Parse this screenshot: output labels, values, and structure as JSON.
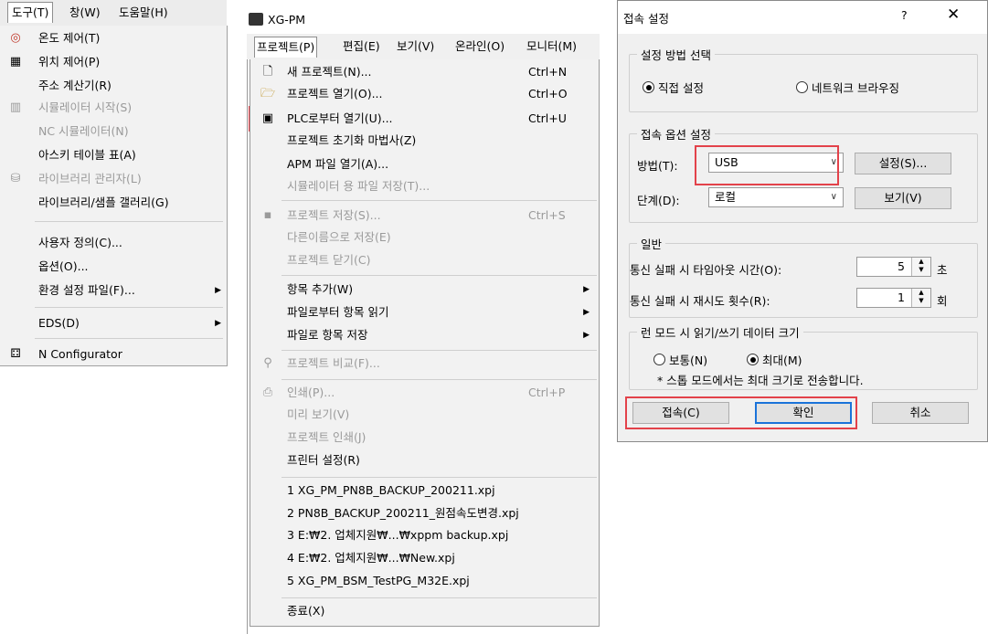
{
  "tools_panel": {
    "menubar": [
      "도구(T)",
      "창(W)",
      "도움말(H)"
    ],
    "items": [
      {
        "icon": "temperature-control-icon",
        "label": "온도 제어(T)",
        "enabled": true
      },
      {
        "icon": "position-control-icon",
        "label": "위치 제어(P)",
        "enabled": true,
        "highlighted": true
      },
      {
        "icon": "",
        "label": "주소 계산기(R)",
        "enabled": true
      },
      {
        "icon": "simulator-icon",
        "label": "시뮬레이터 시작(S)",
        "enabled": false
      },
      {
        "icon": "",
        "label": "NC 시뮬레이터(N)",
        "enabled": false
      },
      {
        "icon": "",
        "label": "아스키 테이블 표(A)",
        "enabled": true
      },
      {
        "icon": "library-icon",
        "label": "라이브러리 관리자(L)",
        "enabled": false
      },
      {
        "icon": "",
        "label": "라이브러리/샘플 갤러리(G)",
        "enabled": true
      },
      {
        "icon": "",
        "label": "사용자 정의(C)...",
        "enabled": true
      },
      {
        "icon": "",
        "label": "옵션(O)...",
        "enabled": true
      },
      {
        "icon": "",
        "label": "환경 설정 파일(F)...",
        "enabled": true,
        "submenu": true
      },
      {
        "icon": "",
        "label": "EDS(D)",
        "enabled": true,
        "submenu": true
      },
      {
        "icon": "n-configurator-icon",
        "label": "N Configurator",
        "enabled": true
      }
    ]
  },
  "project_panel": {
    "app_title": "XG-PM",
    "menubar": [
      "프로젝트(P)",
      "편집(E)",
      "보기(V)",
      "온라인(O)",
      "모니터(M)"
    ],
    "items": [
      {
        "label": "새 프로젝트(N)...",
        "shortcut": "Ctrl+N",
        "enabled": true
      },
      {
        "label": "프로젝트 열기(O)...",
        "shortcut": "Ctrl+O",
        "enabled": true
      },
      {
        "label": "PLC로부터 열기(U)...",
        "shortcut": "Ctrl+U",
        "enabled": true,
        "highlighted": true
      },
      {
        "label": "프로젝트 초기화 마법사(Z)",
        "shortcut": "",
        "enabled": true
      },
      {
        "label": "APM 파일 열기(A)...",
        "shortcut": "",
        "enabled": true
      },
      {
        "label": "시뮬레이터 용 파일 저장(T)...",
        "shortcut": "",
        "enabled": false
      },
      {
        "label": "프로젝트 저장(S)...",
        "shortcut": "Ctrl+S",
        "enabled": false
      },
      {
        "label": "다른이름으로 저장(E)",
        "shortcut": "",
        "enabled": false
      },
      {
        "label": "프로젝트 닫기(C)",
        "shortcut": "",
        "enabled": false
      },
      {
        "label": "항목 추가(W)",
        "shortcut": "",
        "enabled": true,
        "submenu": true
      },
      {
        "label": "파일로부터 항목 읽기",
        "shortcut": "",
        "enabled": true,
        "submenu": true
      },
      {
        "label": "파일로 항목 저장",
        "shortcut": "",
        "enabled": true,
        "submenu": true
      },
      {
        "label": "프로젝트 비교(F)...",
        "shortcut": "",
        "enabled": false
      },
      {
        "label": "인쇄(P)...",
        "shortcut": "Ctrl+P",
        "enabled": false
      },
      {
        "label": "미리 보기(V)",
        "shortcut": "",
        "enabled": false
      },
      {
        "label": "프로젝트 인쇄(J)",
        "shortcut": "",
        "enabled": false
      },
      {
        "label": "프린터 설정(R)",
        "shortcut": "",
        "enabled": true
      },
      {
        "label": "1 XG_PM_PN8B_BACKUP_200211.xpj",
        "shortcut": "",
        "enabled": true
      },
      {
        "label": "2 PN8B_BACKUP_200211_원점속도변경.xpj",
        "shortcut": "",
        "enabled": true
      },
      {
        "label": "3 E:₩2. 업체지원₩...₩xppm backup.xpj",
        "shortcut": "",
        "enabled": true
      },
      {
        "label": "4 E:₩2. 업체지원₩...₩New.xpj",
        "shortcut": "",
        "enabled": true
      },
      {
        "label": "5 XG_PM_BSM_TestPG_M32E.xpj",
        "shortcut": "",
        "enabled": true
      },
      {
        "label": "종료(X)",
        "shortcut": "",
        "enabled": true
      }
    ]
  },
  "connection_dialog": {
    "title": "접속 설정",
    "help": "?",
    "close": "✕",
    "method_group": {
      "title": "설정 방법 선택",
      "direct_label": "직접 설정",
      "network_label": "네트워크 브라우징",
      "selected": "direct"
    },
    "option_group": {
      "title": "접속 옵션 설정",
      "method_label": "방법(T):",
      "method_value": "USB",
      "settings_button": "설정(S)...",
      "level_label": "단계(D):",
      "level_value": "로컬",
      "view_button": "보기(V)"
    },
    "general_group": {
      "title": "일반",
      "timeout_label": "통신 실패 시 타임아웃 시간(O):",
      "timeout_value": "5",
      "timeout_unit": "초",
      "retry_label": "통신 실패 시 재시도 횟수(R):",
      "retry_value": "1",
      "retry_unit": "회"
    },
    "run_mode_group": {
      "title": "런 모드 시 읽기/쓰기 데이터 크기",
      "normal_label": "보통(N)",
      "max_label": "최대(M)",
      "selected": "max",
      "note": "* 스톱 모드에서는 최대 크기로 전송합니다."
    },
    "buttons": {
      "connect": "접속(C)",
      "ok": "확인",
      "cancel": "취소"
    }
  }
}
